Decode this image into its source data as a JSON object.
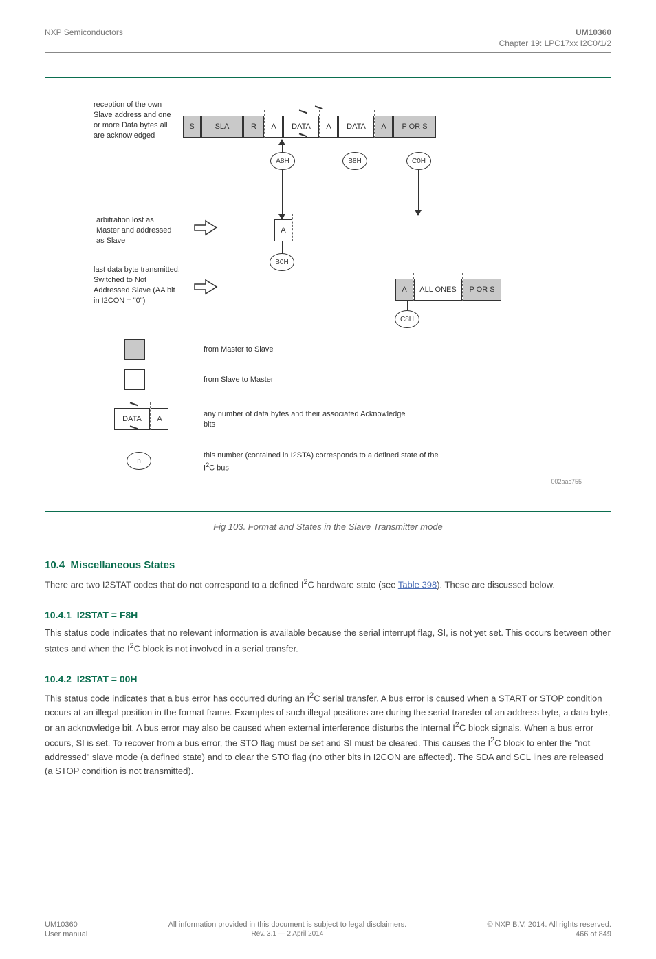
{
  "header": {
    "left": "NXP Semiconductors",
    "center": "UM10360",
    "right_line1": "Chapter 19: LPC17xx I2C0/1/2",
    "right_line2": ""
  },
  "diagram": {
    "row1_label": "reception of the own Slave address and one or more Data bytes all are acknowledged",
    "row2_label": "arbitration lost as Master and addressed as Slave",
    "row3_label": "last data byte transmitted. Switched to Not Addressed Slave (AA bit in I2CON = \"0\")",
    "cells": {
      "S": "S",
      "SLA": "SLA",
      "R": "R",
      "A": "A",
      "DATA": "DATA",
      "A_bar": "A",
      "PORS": "P OR S",
      "ALLONES": "ALL ONES"
    },
    "states": {
      "A8H": "A8H",
      "B8H": "B8H",
      "C0H": "C0H",
      "B0H": "B0H",
      "C8H": "C8H"
    },
    "legend": {
      "m2s": "from Master to Slave",
      "s2m": "from Slave to Master",
      "data_ack": "any number of data bytes and their associated Acknowledge bits",
      "state_desc_a": "this number (contained in I2STA) corresponds to a defined state of the I",
      "state_desc_b": "C bus",
      "n": "n"
    },
    "small_label": "002aac755"
  },
  "figure_caption": "Fig 103. Format and States in the Slave Transmitter mode",
  "section": {
    "number": "10.4",
    "title": "Miscellaneous States",
    "para1_a": "There are two I2STAT codes that do not correspond to a defined I",
    "para1_b": "C hardware state (see ",
    "para1_link": "Table 398",
    "para1_c": "). These are discussed below.",
    "sub_number": "10.4.1",
    "sub_title": "I2STAT = F8H",
    "para2_a": "This status code indicates that no relevant information is available because the serial interrupt flag, SI, is not yet set. This occurs between other states and when the I",
    "para2_b": "C block is not involved in a serial transfer.",
    "sub2_number": "10.4.2",
    "sub2_title": "I2STAT = 00H",
    "para3": "This status code indicates that a bus error has occurred during an I",
    "para3_b": "C serial transfer. A bus error is caused when a START or STOP condition occurs at an illegal position in the format frame. Examples of such illegal positions are during the serial transfer of an address byte, a data byte, or an acknowledge bit. A bus error may also be caused when external interference disturbs the internal I",
    "para3_c": "C block signals. When a bus error occurs, SI is set. To recover from a bus error, the STO flag must be set and SI must be cleared. This causes the I",
    "para3_d": "C block to enter the \"not addressed\" slave mode (a defined state) and to clear the STO flag (no other bits in I2CON are affected). The SDA and SCL lines are released (a STOP condition is not transmitted).",
    "footer_link": "Table 398"
  },
  "footer": {
    "left": "UM10360",
    "mid1": "All information provided in this document is subject to legal disclaimers.",
    "mid2": "Rev. 3.1 — 2 April 2014",
    "right1": "© NXP B.V. 2014. All rights reserved.",
    "right2": "466 of 849",
    "user_manual": "User manual"
  }
}
